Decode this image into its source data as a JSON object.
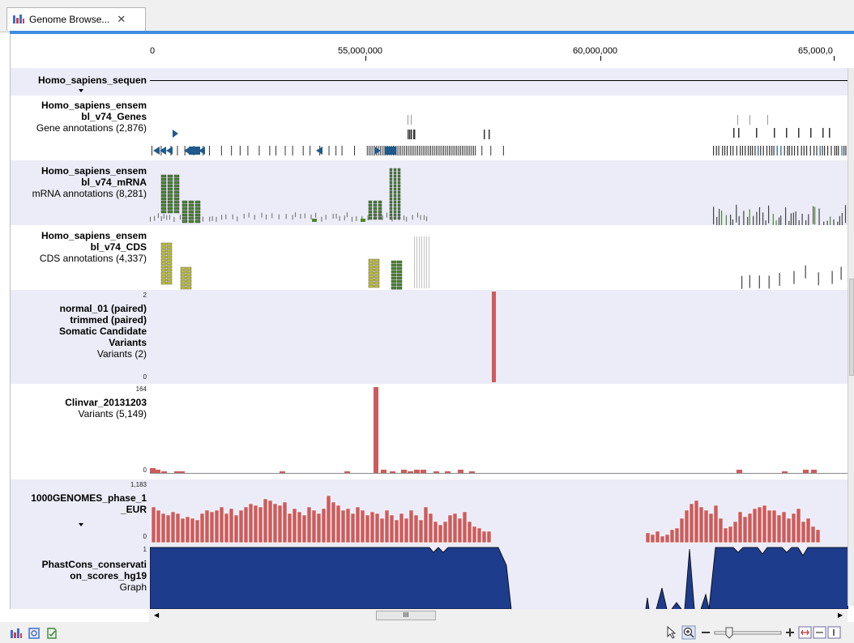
{
  "tab": {
    "title": "Genome Browse...",
    "close": "✕"
  },
  "ruler": {
    "labels": [
      "0",
      "55,000,000",
      "60,000,000",
      "65,000,0"
    ]
  },
  "tracks": {
    "sequence": {
      "name": "Homo_sapiens_sequen"
    },
    "genes": {
      "name1": "Homo_sapiens_ensem",
      "name2": "bl_v74_Genes",
      "sub": "Gene annotations (2,876)"
    },
    "mrna": {
      "name1": "Homo_sapiens_ensem",
      "name2": "bl_v74_mRNA",
      "sub": "mRNA annotations (8,281)"
    },
    "cds": {
      "name1": "Homo_sapiens_ensem",
      "name2": "bl_v74_CDS",
      "sub": "CDS annotations (4,337)"
    },
    "somatic": {
      "name1": "normal_01 (paired)",
      "name2": "trimmed (paired)",
      "name3": "Somatic Candidate",
      "name4": "Variants",
      "sub": "Variants (2)",
      "ymax": "2",
      "ymin": "0"
    },
    "clinvar": {
      "name1": "Clinvar_20131203",
      "sub": "Variants (5,149)",
      "ymax": "164",
      "ymin": "0"
    },
    "g1000": {
      "name1": "1000GENOMES_phase_1",
      "name2": "_EUR",
      "ymax": "1,183",
      "ymin": "0"
    },
    "phast": {
      "name1": "PhastCons_conservati",
      "name2": "on_scores_hg19",
      "sub": "Graph",
      "ymax": "1"
    }
  },
  "scroll": {
    "thumb": "III"
  },
  "colors": {
    "bar": "#cd5c5c",
    "phast": "#1e3c8c",
    "gene": "#1f5a8a",
    "mrna": "#4a8a2a",
    "cds": "#c8c832",
    "band": "#ececf8",
    "accent": "#3c8de0"
  },
  "icons": {
    "status": [
      "track-list-icon",
      "settings-icon",
      "history-icon"
    ],
    "tools": [
      "pointer-icon",
      "zoom-in-icon",
      "zoom-out-icon",
      "zoom-slider",
      "zoom-plus-icon",
      "fit-icon",
      "fit-width-icon",
      "one-to-one-icon"
    ]
  }
}
